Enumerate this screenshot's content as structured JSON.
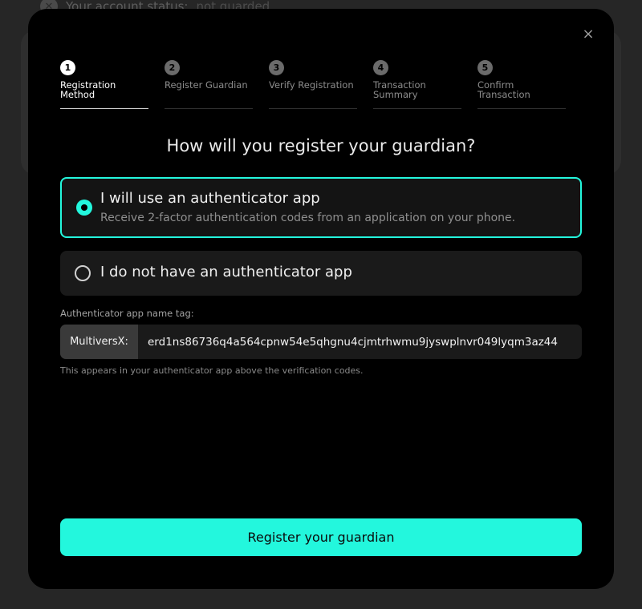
{
  "background": {
    "account_status_label": "Your account status:",
    "account_status_value": "not guarded"
  },
  "modal": {
    "close_icon": "×",
    "steps": [
      {
        "number": "1",
        "label": "Registration Method"
      },
      {
        "number": "2",
        "label": "Register Guardian"
      },
      {
        "number": "3",
        "label": "Verify Registration"
      },
      {
        "number": "4",
        "label": "Transaction Summary"
      },
      {
        "number": "5",
        "label": "Confirm Transaction"
      }
    ],
    "active_step": 1,
    "heading": "How will you register your guardian?",
    "options": [
      {
        "title": "I will use an authenticator app",
        "description": "Receive 2-factor authentication codes from an application on your phone.",
        "selected": true
      },
      {
        "title": "I do not have an authenticator app",
        "selected": false
      }
    ],
    "name_tag": {
      "label": "Authenticator app name tag:",
      "prefix": "MultiversX:",
      "value": "erd1ns86736q4a564cpnw54e5qhgnu4cjmtrhwmu9jyswplnvr049lyqm3az44",
      "help": "This appears in your authenticator app above the verification codes."
    },
    "submit_label": "Register your guardian"
  },
  "colors": {
    "accent": "#23f7dd",
    "modal_bg": "#000000"
  }
}
